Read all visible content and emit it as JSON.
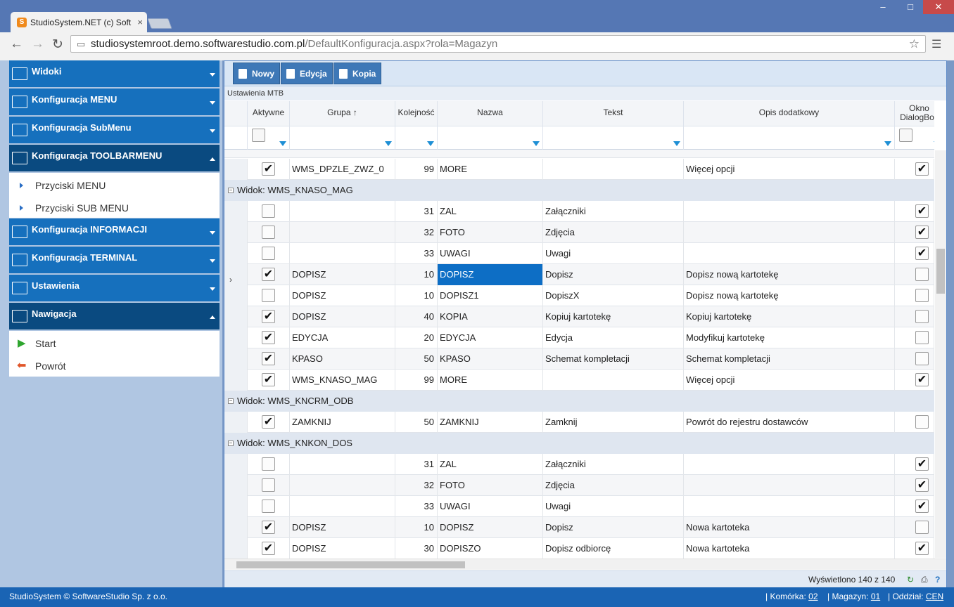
{
  "browser": {
    "tab_title": "StudioSystem.NET (c) Soft",
    "tab_close": "×",
    "window_buttons": [
      "–",
      "□",
      "✕"
    ],
    "url_host": "studiosystemroot.demo.softwarestudio.com.pl",
    "url_path": "/DefaultKonfiguracja.aspx?rola=Magazyn"
  },
  "sidebar": {
    "sections": [
      {
        "label": "Widoki",
        "expanded": false
      },
      {
        "label": "Konfiguracja MENU",
        "expanded": false
      },
      {
        "label": "Konfiguracja SubMenu",
        "expanded": false
      },
      {
        "label": "Konfiguracja TOOLBARMENU",
        "expanded": true,
        "items": [
          "Przyciski MENU",
          "Przyciski SUB MENU"
        ]
      },
      {
        "label": "Konfiguracja INFORMACJI",
        "expanded": false
      },
      {
        "label": "Konfiguracja TERMINAL",
        "expanded": false
      },
      {
        "label": "Ustawienia",
        "expanded": false
      },
      {
        "label": "Nawigacja",
        "expanded": true,
        "items": [
          "Start",
          "Powrót"
        ]
      }
    ]
  },
  "toolbar": {
    "new_label": "Nowy",
    "edit_label": "Edycja",
    "copy_label": "Kopia"
  },
  "grid": {
    "title": "Ustawienia MTB",
    "columns": {
      "aktywne": "Aktywne",
      "grupa": "Grupa",
      "kolejnosc": "Kolejność",
      "nazwa": "Nazwa",
      "tekst": "Tekst",
      "opis": "Opis dodatkowy",
      "okno1": "Okno",
      "okno2": "DialogBox"
    },
    "rows": [
      {
        "type": "row",
        "active": true,
        "grupa": "WMS_DPZLE_ZWZ_0",
        "kol": "99",
        "nazwa": "MORE",
        "tekst": "",
        "opis": "Więcej opcji",
        "okno": true
      },
      {
        "type": "group",
        "label": "Widok: WMS_KNASO_MAG"
      },
      {
        "type": "row",
        "active": false,
        "grupa": "",
        "kol": "31",
        "nazwa": "ZAL",
        "tekst": "Załączniki",
        "opis": "",
        "okno": true
      },
      {
        "type": "row",
        "active": false,
        "grupa": "",
        "kol": "32",
        "nazwa": "FOTO",
        "tekst": "Zdjęcia",
        "opis": "",
        "okno": true
      },
      {
        "type": "row",
        "active": false,
        "grupa": "",
        "kol": "33",
        "nazwa": "UWAGI",
        "tekst": "Uwagi",
        "opis": "",
        "okno": true
      },
      {
        "type": "row",
        "active": true,
        "grupa": "DOPISZ",
        "kol": "10",
        "nazwa": "DOPISZ",
        "tekst": "Dopisz",
        "opis": "Dopisz nową kartotekę",
        "okno": false,
        "selected": true
      },
      {
        "type": "row",
        "active": false,
        "grupa": "DOPISZ",
        "kol": "10",
        "nazwa": "DOPISZ1",
        "tekst": "DopiszX",
        "opis": "Dopisz nową kartotekę",
        "okno": false
      },
      {
        "type": "row",
        "active": true,
        "grupa": "DOPISZ",
        "kol": "40",
        "nazwa": "KOPIA",
        "tekst": "Kopiuj kartotekę",
        "opis": "Kopiuj kartotekę",
        "okno": false
      },
      {
        "type": "row",
        "active": true,
        "grupa": "EDYCJA",
        "kol": "20",
        "nazwa": "EDYCJA",
        "tekst": "Edycja",
        "opis": "Modyfikuj kartotekę",
        "okno": false
      },
      {
        "type": "row",
        "active": true,
        "grupa": "KPASO",
        "kol": "50",
        "nazwa": "KPASO",
        "tekst": "Schemat kompletacji",
        "opis": "Schemat kompletacji",
        "okno": false
      },
      {
        "type": "row",
        "active": true,
        "grupa": "WMS_KNASO_MAG",
        "kol": "99",
        "nazwa": "MORE",
        "tekst": "",
        "opis": "Więcej opcji",
        "okno": true
      },
      {
        "type": "group",
        "label": "Widok: WMS_KNCRM_ODB"
      },
      {
        "type": "row",
        "active": true,
        "grupa": "ZAMKNIJ",
        "kol": "50",
        "nazwa": "ZAMKNIJ",
        "tekst": "Zamknij",
        "opis": "Powrót do rejestru dostawców",
        "okno": false
      },
      {
        "type": "group",
        "label": "Widok: WMS_KNKON_DOS"
      },
      {
        "type": "row",
        "active": false,
        "grupa": "",
        "kol": "31",
        "nazwa": "ZAL",
        "tekst": "Załączniki",
        "opis": "",
        "okno": true
      },
      {
        "type": "row",
        "active": false,
        "grupa": "",
        "kol": "32",
        "nazwa": "FOTO",
        "tekst": "Zdjęcia",
        "opis": "",
        "okno": true
      },
      {
        "type": "row",
        "active": false,
        "grupa": "",
        "kol": "33",
        "nazwa": "UWAGI",
        "tekst": "Uwagi",
        "opis": "",
        "okno": true
      },
      {
        "type": "row",
        "active": true,
        "grupa": "DOPISZ",
        "kol": "10",
        "nazwa": "DOPISZ",
        "tekst": "Dopisz",
        "opis": "Nowa kartoteka",
        "okno": false
      },
      {
        "type": "row",
        "active": true,
        "grupa": "DOPISZ",
        "kol": "30",
        "nazwa": "DOPISZO",
        "tekst": "Dopisz odbiorcę",
        "opis": "Nowa kartoteka",
        "okno": true
      }
    ]
  },
  "pager": {
    "status": "Wyświetlono 140 z 140"
  },
  "footer": {
    "copyright": "StudioSystem © SoftwareStudio Sp. z o.o.",
    "komorka_label": "Komórka:",
    "komorka_value": "02",
    "magazyn_label": "Magazyn:",
    "magazyn_value": "01",
    "oddzial_label": "Oddział:",
    "oddzial_value": "CEN"
  }
}
